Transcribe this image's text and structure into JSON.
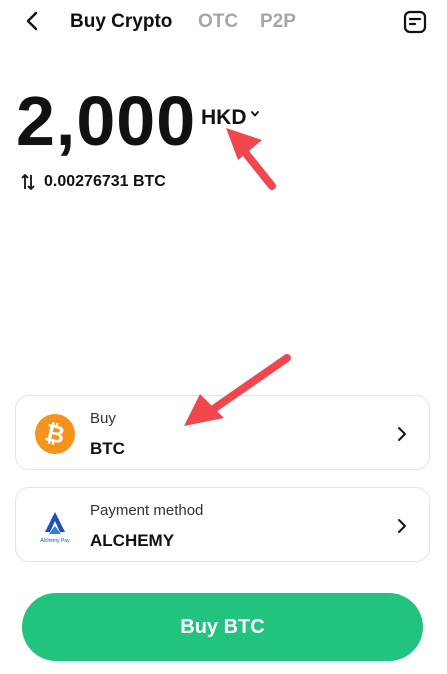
{
  "header": {
    "back_icon": "back-arrow-icon",
    "tabs": [
      {
        "label": "Buy Crypto",
        "active": true
      },
      {
        "label": "OTC",
        "active": false
      },
      {
        "label": "P2P",
        "active": false
      }
    ],
    "orders_icon": "orders-document-icon"
  },
  "amount": {
    "value": "2,000",
    "currency": "HKD"
  },
  "conversion": {
    "icon": "swap-vertical-icon",
    "text": "0.00276731 BTC"
  },
  "buy_card": {
    "label": "Buy",
    "value": "BTC",
    "icon": "bitcoin-icon"
  },
  "payment_card": {
    "label": "Payment method",
    "value": "ALCHEMY",
    "icon": "alchemy-pay-logo",
    "logo_text": "Alchemy Pay"
  },
  "primary_button": {
    "label": "Buy BTC"
  },
  "colors": {
    "accent_green": "#22c27f",
    "bitcoin_orange": "#f7931a",
    "inactive_tab": "#a6a6a6",
    "annotation_red": "#f0474f"
  }
}
